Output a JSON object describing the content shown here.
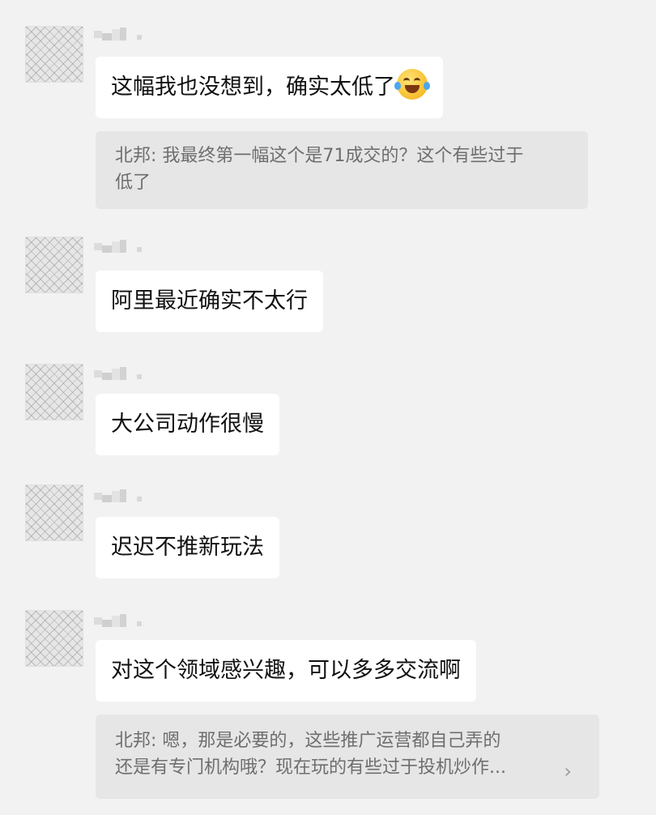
{
  "messages": [
    {
      "sender": "",
      "text": "这幅我也没想到，确实太低了",
      "emoji": "rolling-on-floor-laughing-emoji"
    },
    {
      "sender": "",
      "text": "阿里最近确实不太行"
    },
    {
      "sender": "",
      "text": "大公司动作很慢"
    },
    {
      "sender": "",
      "text": "迟迟不推新玩法"
    },
    {
      "sender": "",
      "text": "对这个领域感兴趣，可以多多交流啊"
    }
  ],
  "quotes": [
    {
      "lines": [
        "北邦: 我最终第一幅这个是71成交的？这个有些过于",
        "低了"
      ]
    },
    {
      "lines": [
        "北邦: 嗯，那是必要的，这些推广运营都自己弄的",
        "还是有专门机构哦？现在玩的有些过于投机炒作..."
      ],
      "expand_icon": "chevron-right-icon"
    }
  ],
  "colors": {
    "background": "#f2f2f2",
    "bubble": "#ffffff",
    "quote_background": "#e6e6e6",
    "quote_text": "#6e6e6e",
    "message_text": "#111111"
  }
}
